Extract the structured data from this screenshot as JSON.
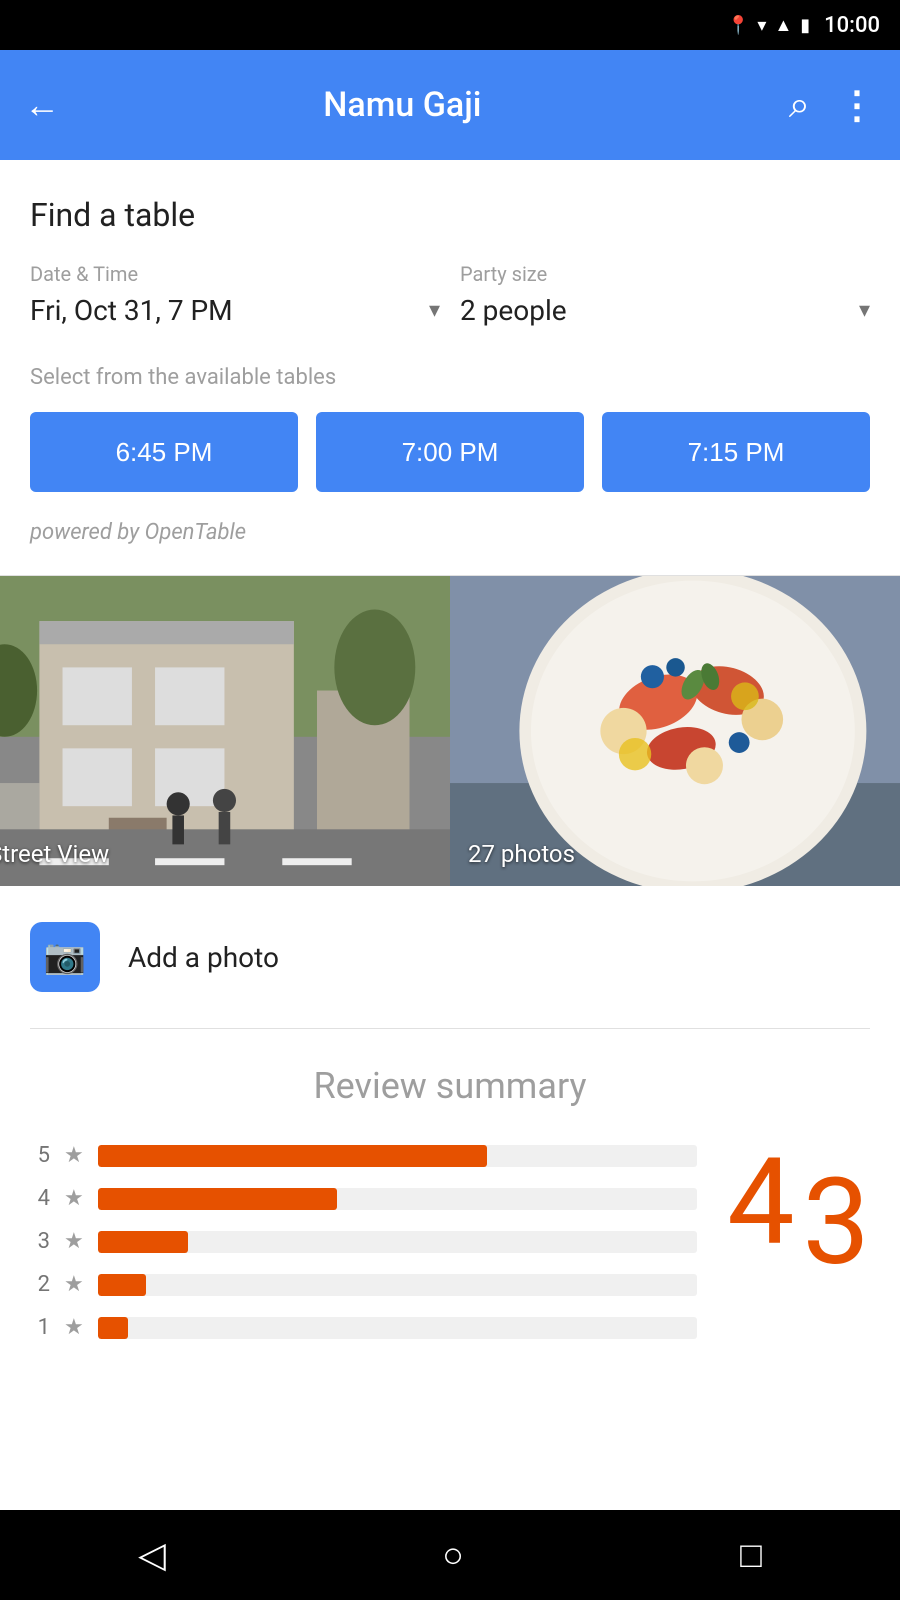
{
  "statusBar": {
    "time": "10:00",
    "icons": [
      "location-pin",
      "wifi",
      "signal",
      "battery"
    ]
  },
  "appBar": {
    "title": "Namu Gaji",
    "backLabel": "←",
    "searchLabel": "⌕",
    "moreLabel": "⋮"
  },
  "findTable": {
    "heading": "Find a table",
    "dateLabel": "Date & Time",
    "dateValue": "Fri, Oct 31, 7 PM",
    "partySizeLabel": "Party size",
    "partySizeValue": "2 people",
    "availableLabel": "Select from the available tables",
    "timeSlots": [
      "6:45 PM",
      "7:00 PM",
      "7:15 PM"
    ],
    "poweredBy": "powered by OpenTable"
  },
  "photos": {
    "streetViewLabel": "Street View",
    "photosLabel": "27 photos",
    "addPhotoLabel": "Add a photo"
  },
  "reviewSummary": {
    "title": "Review summary",
    "bigRating1": "4",
    "bigRating2": "3",
    "bars": [
      {
        "stars": 5,
        "width": 65
      },
      {
        "stars": 4,
        "width": 40
      },
      {
        "stars": 3,
        "width": 15
      },
      {
        "stars": 2,
        "width": 8
      },
      {
        "stars": 1,
        "width": 5
      }
    ]
  },
  "navBar": {
    "backIcon": "◁",
    "homeIcon": "○",
    "recentIcon": "□"
  }
}
